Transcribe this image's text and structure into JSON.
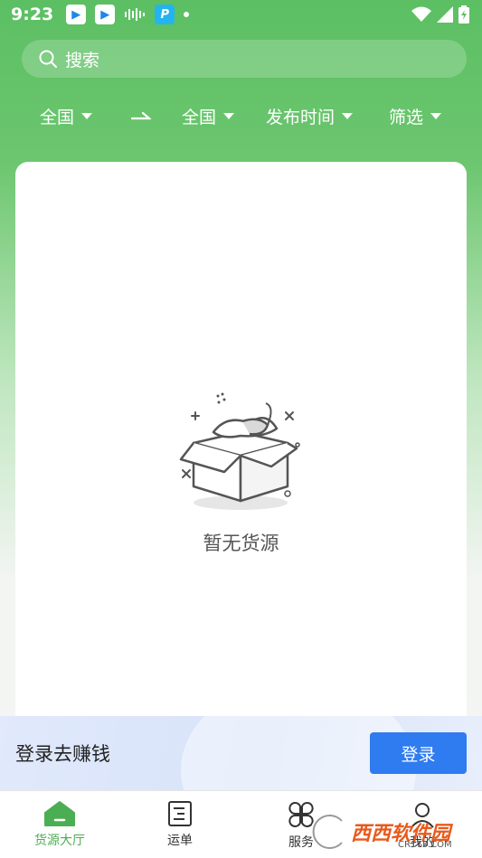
{
  "status_bar": {
    "time": "9:23",
    "icons": [
      "app-blue-icon",
      "app-blue-icon",
      "audio-wave-icon",
      "pp-app-icon",
      "dot-icon"
    ],
    "right_icons": [
      "wifi-icon",
      "signal-icon",
      "battery-icon"
    ]
  },
  "search": {
    "placeholder": "搜索"
  },
  "filters": {
    "origin": "全国",
    "arrow": "⇀",
    "destination": "全国",
    "publish_time": "发布时间",
    "filter": "筛选"
  },
  "empty_state": {
    "text": "暂无货源"
  },
  "login_banner": {
    "label": "登录去赚钱",
    "button": "登录"
  },
  "bottom_nav": [
    {
      "label": "货源大厅",
      "icon": "home-icon",
      "active": true
    },
    {
      "label": "运单",
      "icon": "waybill-icon",
      "active": false
    },
    {
      "label": "服务",
      "icon": "service-icon",
      "active": false
    },
    {
      "label": "我的",
      "icon": "user-icon",
      "active": false
    }
  ],
  "watermark": {
    "text": "西西软件园",
    "sub": "CR173.COM"
  },
  "colors": {
    "primary_green": "#5cbf63",
    "accent_blue": "#2f7bf0",
    "active_nav": "#4cae52"
  }
}
